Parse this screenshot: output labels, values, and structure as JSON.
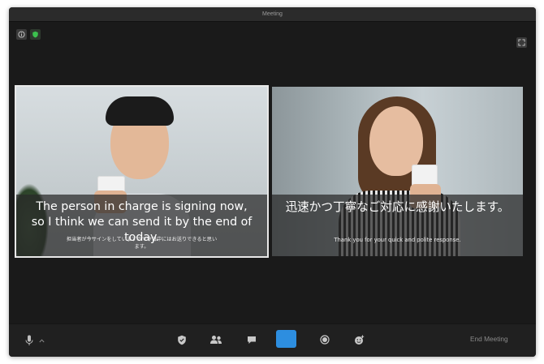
{
  "window": {
    "title": "Meeting"
  },
  "colors": {
    "accent": "#2d8ee0",
    "active_border": "#e8e8e8",
    "toolbar_bg": "#202020"
  },
  "top_bar": {
    "info_icon": "info-icon",
    "security_status_icon": "shield-check-icon",
    "fullscreen_icon": "fullscreen-icon"
  },
  "participants": [
    {
      "caption_main": "The person in charge is signing now, so I think we can send it by the end of today.",
      "caption_sub": "担当者が今サインをしていますので今日中にはお送りできると思います。",
      "active": true
    },
    {
      "caption_main": "迅速かつ丁寧なご対応に感謝いたします。",
      "caption_sub": "Thank you for your quick and polite response.",
      "active": false
    }
  ],
  "toolbar": {
    "icons": [
      "microphone-icon",
      "chevron-up-icon",
      "shield-icon",
      "participants-icon",
      "chat-icon",
      "share-screen-icon",
      "record-icon",
      "reactions-icon"
    ],
    "end_meeting_label": "End Meeting"
  }
}
